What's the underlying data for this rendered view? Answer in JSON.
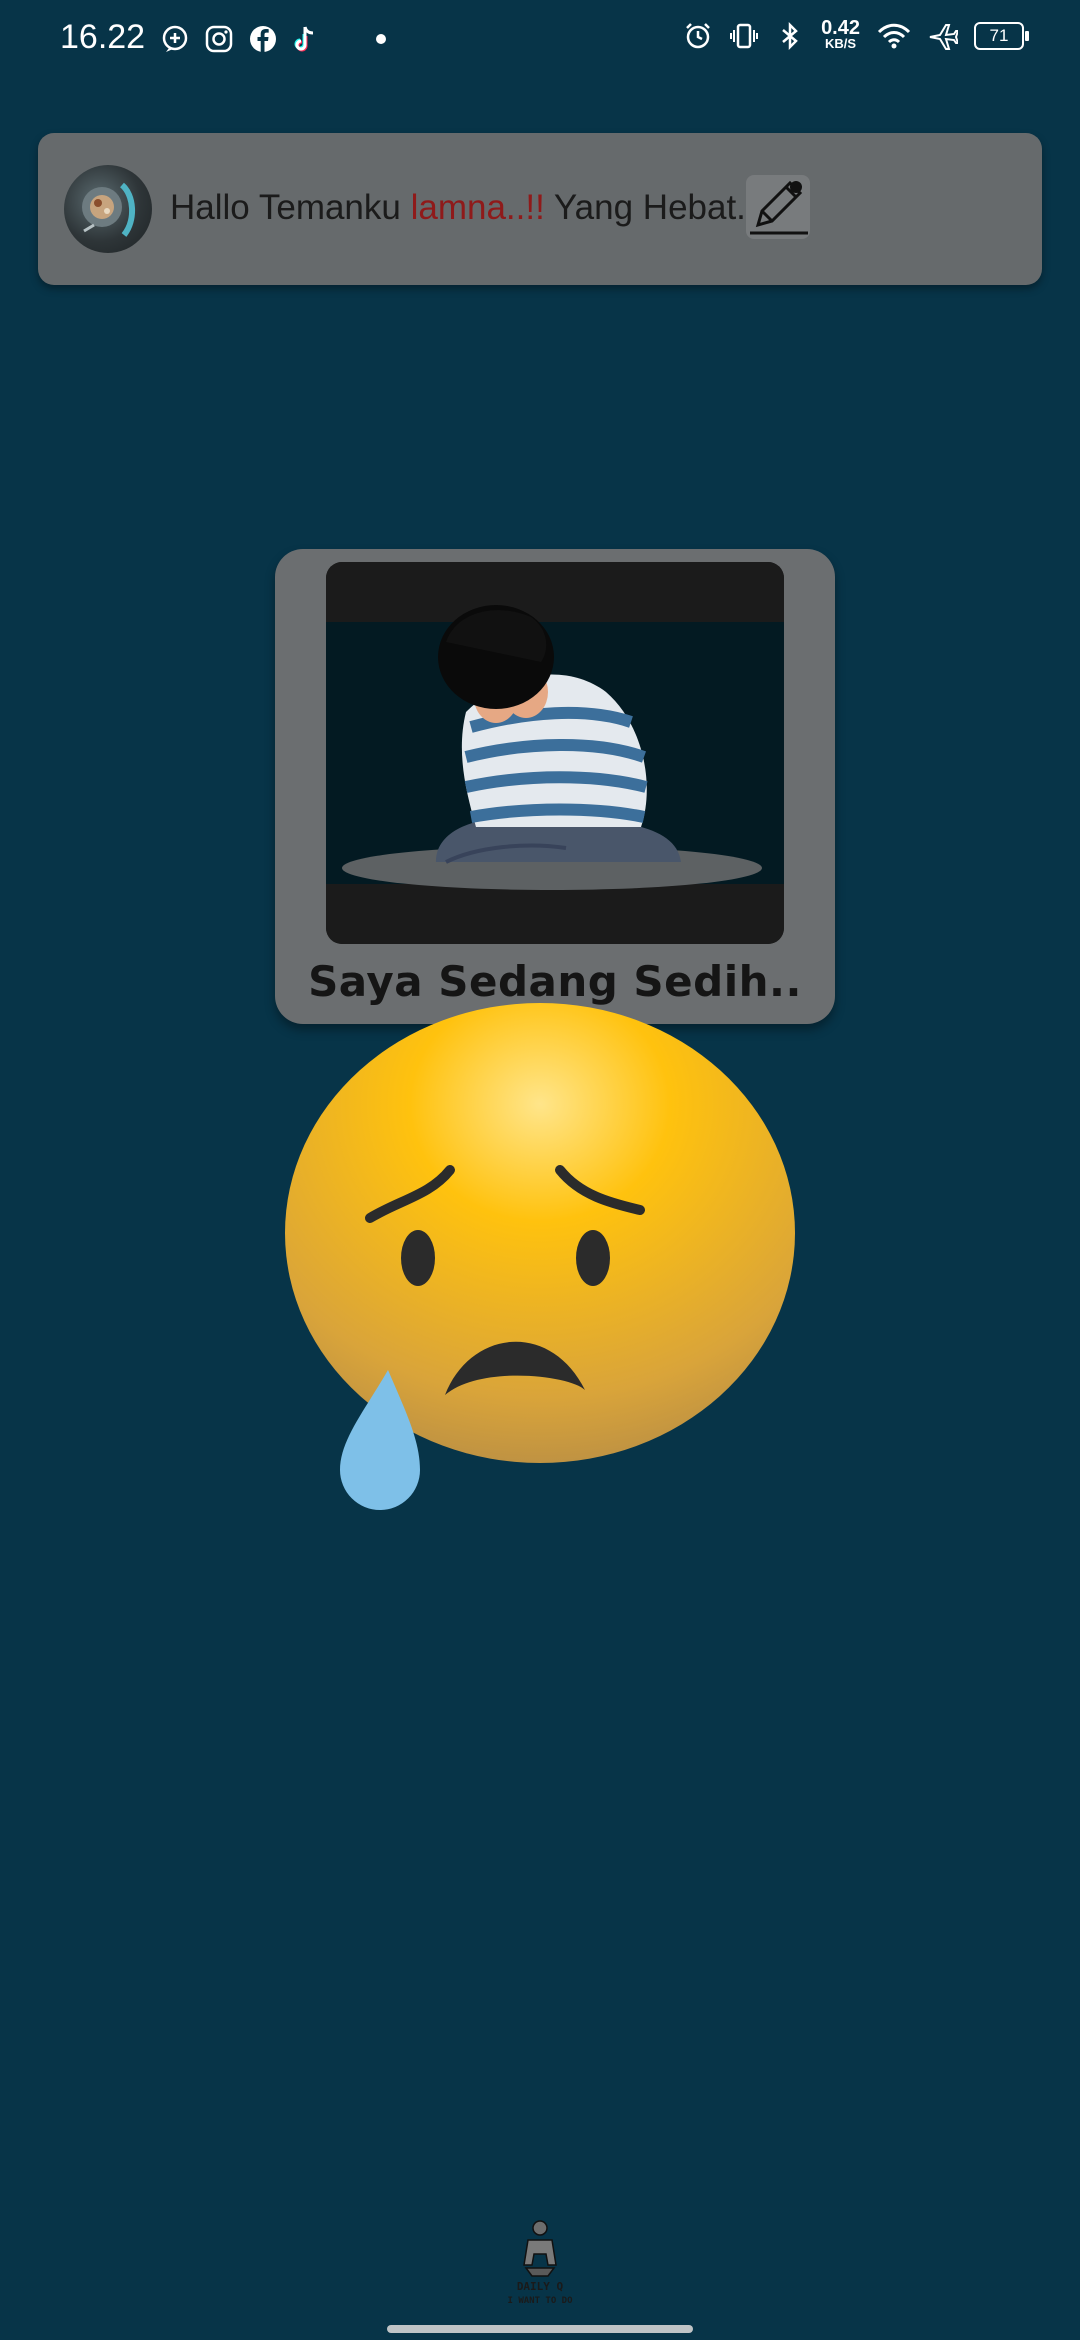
{
  "status_bar": {
    "time": "16.22",
    "speed_value": "0.42",
    "speed_unit": "KB/S",
    "battery": "71"
  },
  "greeting": {
    "prefix": "Hallo Temanku ",
    "name": "lamna..!!",
    "suffix": " Yang Hebat.."
  },
  "mood": {
    "title": "Saya Sedang Sedih.."
  },
  "logo": {
    "line1": "DAILY Q",
    "line2": "I WANT TO DO"
  },
  "colors": {
    "background": "#073448",
    "card": "#666a6c",
    "name_accent": "#8f1a1a",
    "emoji_yellow": "#ffc20e",
    "tear_blue": "#7ec0e8"
  },
  "icons": [
    "message-plus-icon",
    "instagram-icon",
    "facebook-icon",
    "tiktok-icon",
    "alarm-icon",
    "vibrate-icon",
    "bluetooth-icon",
    "wifi-icon",
    "airplane-icon",
    "battery-icon",
    "pencil-icon"
  ]
}
